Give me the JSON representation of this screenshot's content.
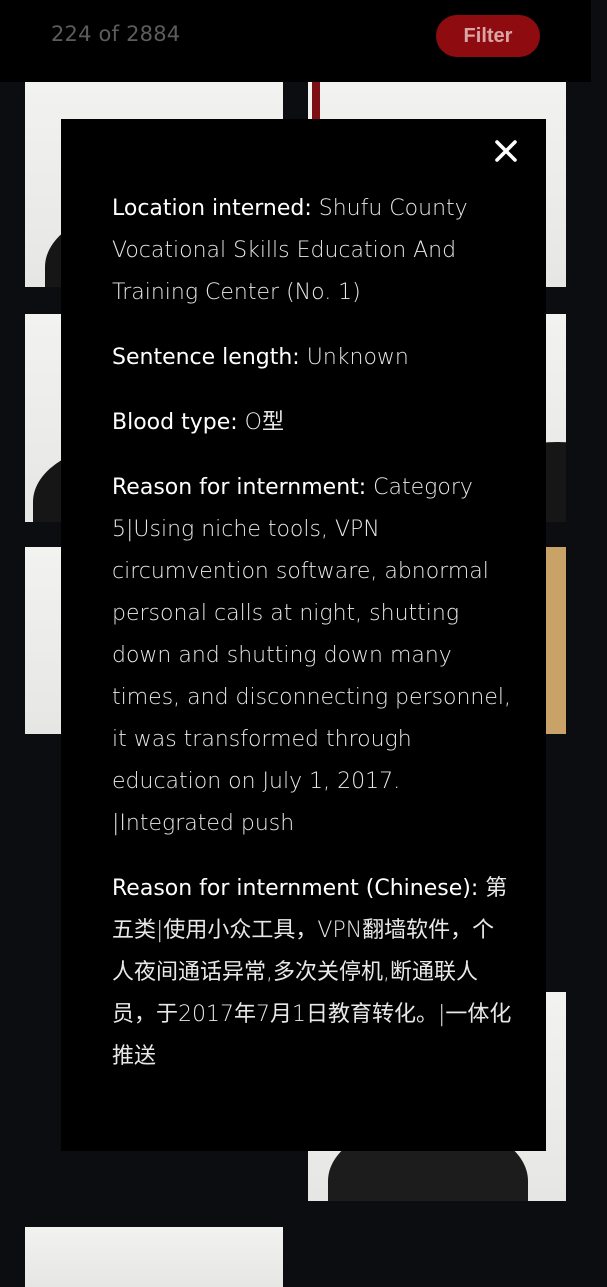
{
  "header": {
    "counter": "224 of 2884",
    "filter_label": "Filter"
  },
  "colors": {
    "background": "#0b0d10",
    "modal_bg": "#000000",
    "accent_red": "#8e0c10",
    "text": "#ffffff"
  },
  "modal": {
    "close_icon": "close-icon",
    "fields": [
      {
        "label": "Location interned:",
        "value": " Shufu County Vocational Skills Education And Training Center (No. 1)"
      },
      {
        "label": "Sentence length:",
        "value": " Unknown"
      },
      {
        "label": "Blood type:",
        "value": " O型"
      },
      {
        "label": "Reason for internment:",
        "value": " Category 5|Using niche tools, VPN circumvention software, abnormal personal calls at night, shutting down and shutting down many times, and disconnecting personnel, it was transformed through education on July 1, 2017. |Integrated push"
      },
      {
        "label": "Reason for internment (Chinese):",
        "value": " 第五类|使用小众工具，VPN翻墙软件，个人夜间通话异常,多次关停机,断通联人员，于2017年7月1日教育转化。|一体化推送"
      }
    ]
  }
}
